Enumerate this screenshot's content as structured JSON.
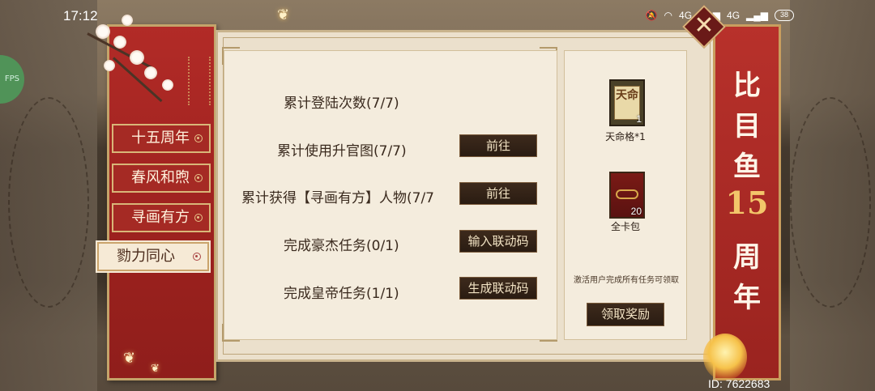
{
  "status_bar": {
    "time": "17:12",
    "net_label_1": "4G",
    "net_label_2": "4G",
    "battery": "38"
  },
  "side_bubble": {
    "label": "FPS"
  },
  "tabs": [
    {
      "label": "十五周年",
      "active": false
    },
    {
      "label": "春风和煦",
      "active": false
    },
    {
      "label": "寻画有方",
      "active": false
    },
    {
      "label": "勠力同心",
      "active": true
    }
  ],
  "tasks": [
    {
      "label": "累计登陆次数(7/7)",
      "button": ""
    },
    {
      "label": "累计使用升官图(7/7)",
      "button": "前往"
    },
    {
      "label": "累计获得【寻画有方】人物(7/7",
      "button": "前往"
    },
    {
      "label": "完成豪杰任务(0/1)",
      "button": "输入联动码"
    },
    {
      "label": "完成皇帝任务(1/1)",
      "button": "生成联动码"
    }
  ],
  "rewards": [
    {
      "name": "天命格*1",
      "count": "1",
      "icon_text": "天命",
      "icon": "fate-card-icon"
    },
    {
      "name": "全卡包",
      "count": "20",
      "icon": "card-pack-icon"
    }
  ],
  "reward_hint": "激活用户完成所有任务可领取",
  "claim_button": "领取奖励",
  "title": {
    "line1": "比",
    "line2": "目",
    "line3": "鱼",
    "line4": "15",
    "line5": "周",
    "line6": "年"
  },
  "close_label": "✕",
  "player_id": "ID: 7622683",
  "colors": {
    "banner_red": "#b22b27",
    "parchment": "#ebe0cc",
    "button_dark": "#2a1c12",
    "gold": "#f3c66a"
  }
}
